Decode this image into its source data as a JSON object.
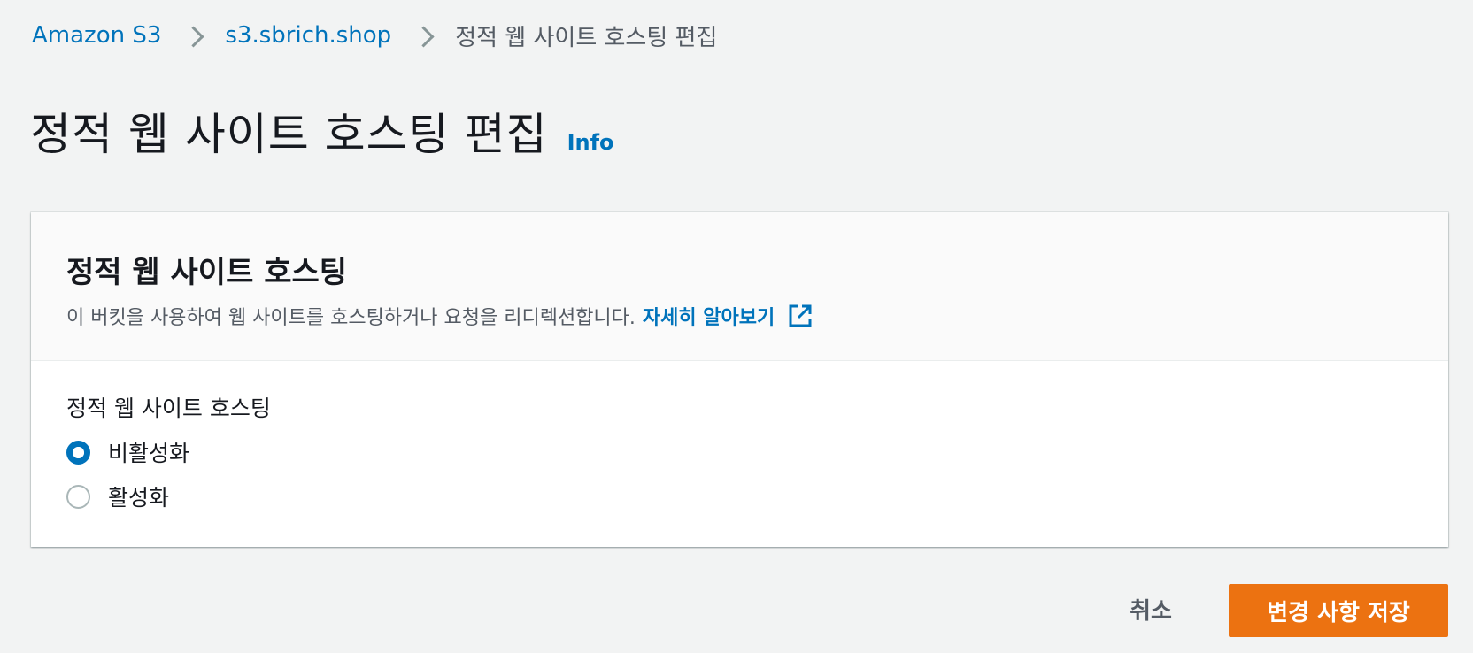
{
  "breadcrumb": {
    "items": [
      {
        "label": "Amazon S3",
        "link": true
      },
      {
        "label": "s3.sbrich.shop",
        "link": true
      },
      {
        "label": "정적 웹 사이트 호스팅 편집",
        "link": false
      }
    ]
  },
  "header": {
    "title": "정적 웹 사이트 호스팅 편집",
    "info_label": "Info"
  },
  "panel": {
    "title": "정적 웹 사이트 호스팅",
    "description": "이 버킷을 사용하여 웹 사이트를 호스팅하거나 요청을 리디렉션합니다.",
    "learn_more": "자세히 알아보기",
    "field_label": "정적 웹 사이트 호스팅",
    "options": [
      {
        "label": "비활성화",
        "checked": true
      },
      {
        "label": "활성화",
        "checked": false
      }
    ]
  },
  "actions": {
    "cancel_label": "취소",
    "save_label": "변경 사항 저장"
  },
  "colors": {
    "link": "#0073bb",
    "primary_button": "#ec7211",
    "background": "#f2f3f3"
  }
}
